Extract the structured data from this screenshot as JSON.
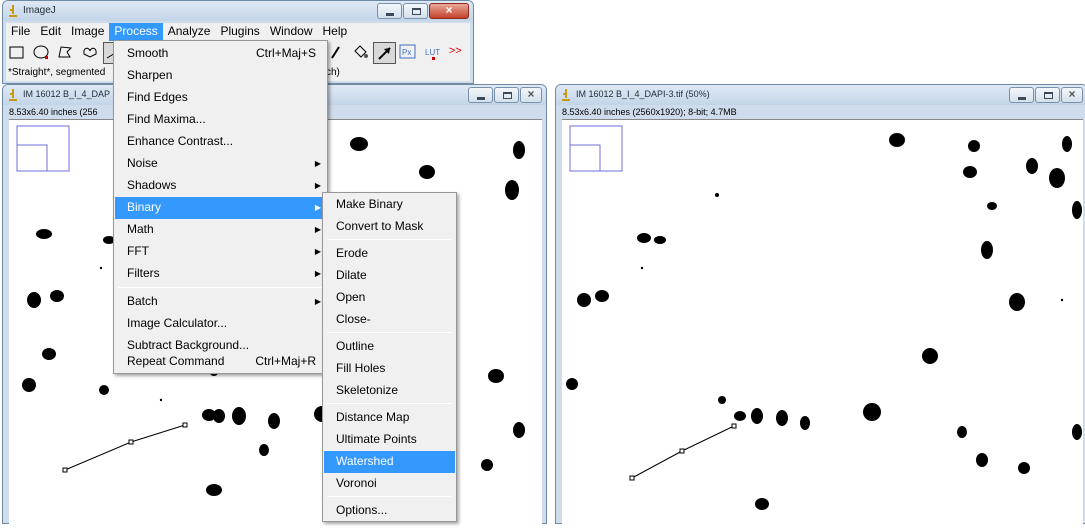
{
  "imagej": {
    "title": "ImageJ",
    "menus": [
      "File",
      "Edit",
      "Image",
      "Process",
      "Analyze",
      "Plugins",
      "Window",
      "Help"
    ],
    "active_menu": "Process",
    "status": "*Straight*, segmented",
    "status_tail": "ch)",
    "lut_label": "LUT",
    "more_label": ">>",
    "px_label": "Px"
  },
  "windows": [
    {
      "title": "IM 16012 B_I_4_DAP",
      "info": "8.53x6.40 inches (256"
    },
    {
      "title": "IM 16012 B_I_4_DAPI-3.tif (50%)",
      "info": "8.53x6.40 inches (2560x1920); 8-bit; 4.7MB"
    }
  ],
  "process_menu": {
    "items": [
      {
        "label": "Smooth",
        "shortcut": "Ctrl+Maj+S"
      },
      {
        "label": "Sharpen"
      },
      {
        "label": "Find Edges"
      },
      {
        "label": "Find Maxima..."
      },
      {
        "label": "Enhance Contrast..."
      },
      {
        "label": "Noise",
        "submenu": true
      },
      {
        "label": "Shadows",
        "submenu": true
      },
      {
        "label": "Binary",
        "submenu": true,
        "highlighted": true
      },
      {
        "label": "Math",
        "submenu": true
      },
      {
        "label": "FFT",
        "submenu": true
      },
      {
        "label": "Filters",
        "submenu": true
      },
      {
        "label": "Batch",
        "submenu": true
      },
      {
        "label": "Image Calculator..."
      },
      {
        "label": "Subtract Background..."
      },
      {
        "label": "Repeat Command",
        "shortcut": "Ctrl+Maj+R"
      }
    ]
  },
  "binary_menu": {
    "items": [
      {
        "label": "Make Binary"
      },
      {
        "label": "Convert to Mask"
      },
      {
        "label": "Erode"
      },
      {
        "label": "Dilate"
      },
      {
        "label": "Open"
      },
      {
        "label": "Close-"
      },
      {
        "label": "Outline"
      },
      {
        "label": "Fill Holes"
      },
      {
        "label": "Skeletonize"
      },
      {
        "label": "Distance Map"
      },
      {
        "label": "Ultimate Points"
      },
      {
        "label": "Watershed",
        "highlighted": true
      },
      {
        "label": "Voronoi"
      },
      {
        "label": "Options..."
      }
    ]
  },
  "colors": {
    "menu_highlight": "#3399ff",
    "window_frame": "#cfdceb",
    "roi_line": "#000000",
    "navigator": "#6f6fd8"
  }
}
